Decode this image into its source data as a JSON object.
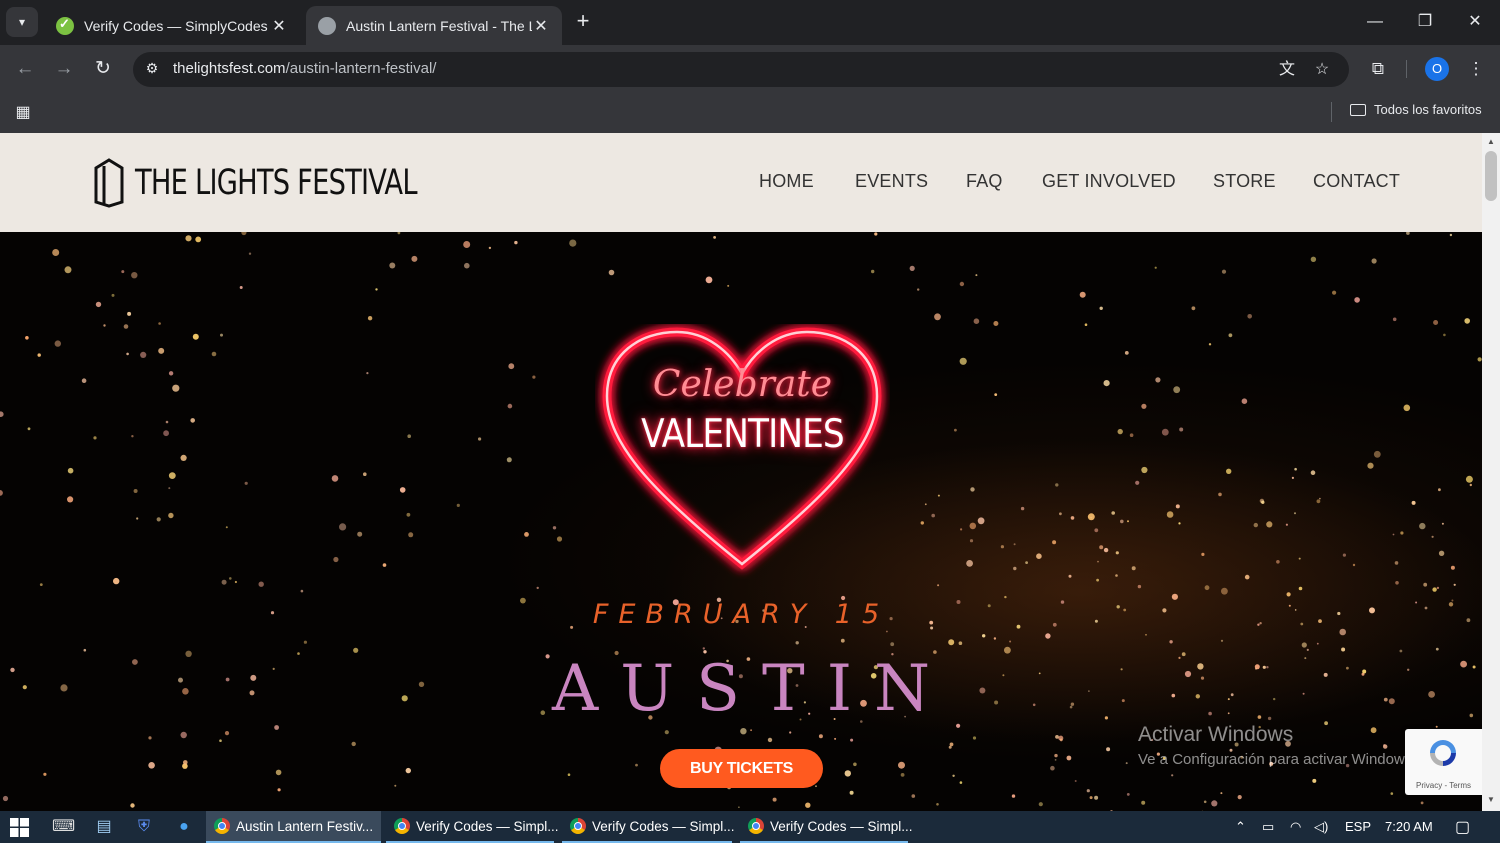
{
  "browser": {
    "tabs": [
      {
        "title": "Verify Codes — SimplyCodes"
      },
      {
        "title": "Austin Lantern Festival - The Lig"
      }
    ],
    "url_domain": "thelightsfest.com",
    "url_path": "/austin-lantern-festival/",
    "profile_initial": "O",
    "bookmarks_folder": "Todos los favoritos"
  },
  "site": {
    "logo_text": "THE LIGHTS FESTIVAL",
    "nav": [
      "HOME",
      "EVENTS",
      "FAQ",
      "GET INVOLVED",
      "STORE",
      "CONTACT"
    ],
    "hero": {
      "celebrate": "Celebrate",
      "valentines": "VALENTINES",
      "date": "FEBRUARY 15",
      "city": "AUSTIN",
      "cta": "BUY TICKETS"
    }
  },
  "overlay": {
    "activate_title": "Activar Windows",
    "activate_sub": "Ve a Configuración para activar Windows.",
    "recaptcha": "Privacy - Terms"
  },
  "taskbar": {
    "apps": [
      "Austin Lantern Festiv...",
      "Verify Codes — Simpl...",
      "Verify Codes — Simpl...",
      "Verify Codes — Simpl..."
    ],
    "language": "ESP",
    "time": "7:20 AM"
  }
}
